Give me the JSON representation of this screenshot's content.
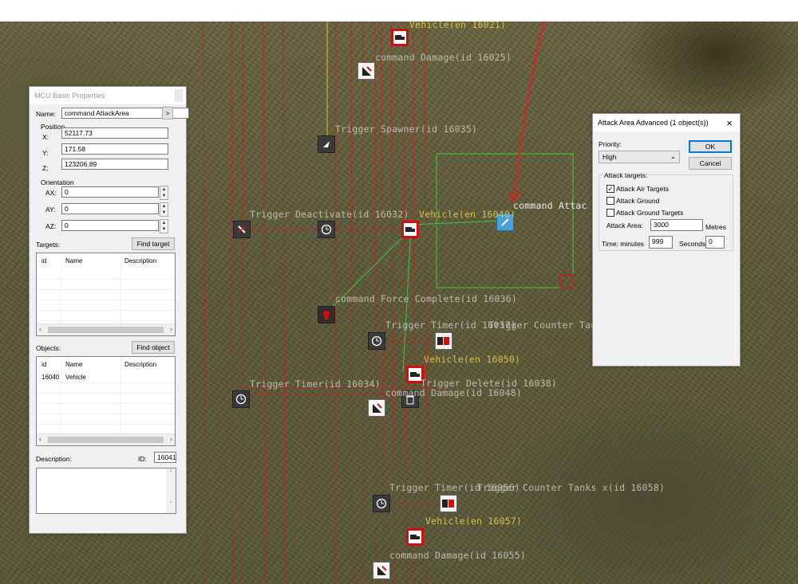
{
  "map": {
    "labels": [
      {
        "id": "veh1",
        "text": "Vehicle(en 16021)",
        "color": "y"
      },
      {
        "id": "dmg1",
        "text": "command Damage(id 16025)",
        "color": "g"
      },
      {
        "id": "spawn",
        "text": "Trigger Spawner(id 16035)",
        "color": "g"
      },
      {
        "id": "deact",
        "text": "Trigger Deactivate(id 16032)",
        "color": "g"
      },
      {
        "id": "veh2",
        "text": "Vehicle(en 16040)",
        "color": "y"
      },
      {
        "id": "attack",
        "text": "command Attac",
        "color": "w"
      },
      {
        "id": "force",
        "text": "command Force Complete(id 16036)",
        "color": "g"
      },
      {
        "id": "timer1",
        "text": "Trigger Timer(id 16037)",
        "color": "g"
      },
      {
        "id": "counter1",
        "text": "Trigger Counter Tanks",
        "color": "g"
      },
      {
        "id": "veh3",
        "text": "Vehicle(en 16050)",
        "color": "y"
      },
      {
        "id": "timer2",
        "text": "Trigger Timer(id 16034)",
        "color": "g"
      },
      {
        "id": "delete",
        "text": "Trigger Delete(id 16038)",
        "color": "g"
      },
      {
        "id": "dmg2",
        "text": "command Damage(id 16048)",
        "color": "g"
      },
      {
        "id": "timer3",
        "text": "Trigger Timer(id 16056)",
        "color": "g"
      },
      {
        "id": "counter2",
        "text": "Trigger Counter Tanks  x(id 16058)",
        "color": "g"
      },
      {
        "id": "veh4",
        "text": "Vehicle(en 16057)",
        "color": "y"
      },
      {
        "id": "dmg3",
        "text": "command Damage(id 16055)",
        "color": "g"
      }
    ]
  },
  "mcu": {
    "title": "MCU Basic Properties",
    "name_label": "Name:",
    "name_value": "command AttackArea",
    "name_btn": ">",
    "position_label": "Position",
    "x_label": "X:",
    "x_value": "52117.73",
    "y_label": "Y:",
    "y_value": "171.58",
    "z_label": "Z:",
    "z_value": "123206.89",
    "orientation_label": "Orientation",
    "ax_label": "AX:",
    "ax_value": "0",
    "ay_label": "AY:",
    "ay_value": "0",
    "az_label": "AZ:",
    "az_value": "0",
    "targets_label": "Targets:",
    "find_target": "Find target",
    "col_id": "id",
    "col_name": "Name",
    "col_desc": "Description",
    "objects_label": "Objects:",
    "find_object": "Find object",
    "object_row": {
      "id": "16040",
      "name": "Vehicle"
    },
    "description_label": "Description:",
    "id_label": "ID:",
    "id_value": "16041"
  },
  "attack": {
    "title": "Attack Area Advanced (1 object(s))",
    "close": "×",
    "priority_label": "Priority:",
    "priority_value": "High",
    "ok": "OK",
    "cancel": "Cancel",
    "targets_group": "Attack targets:",
    "air": "Attack Air Targets",
    "ground": "Attack Ground",
    "ground_targets": "Attack Ground Targets",
    "air_checked": "✓",
    "area_label": "Attack Area:",
    "area_value": "3000",
    "area_unit": "Metres",
    "time_label": "Time: minutes",
    "minutes_value": "999",
    "seconds_label": "Seconds",
    "seconds_value": "0"
  }
}
